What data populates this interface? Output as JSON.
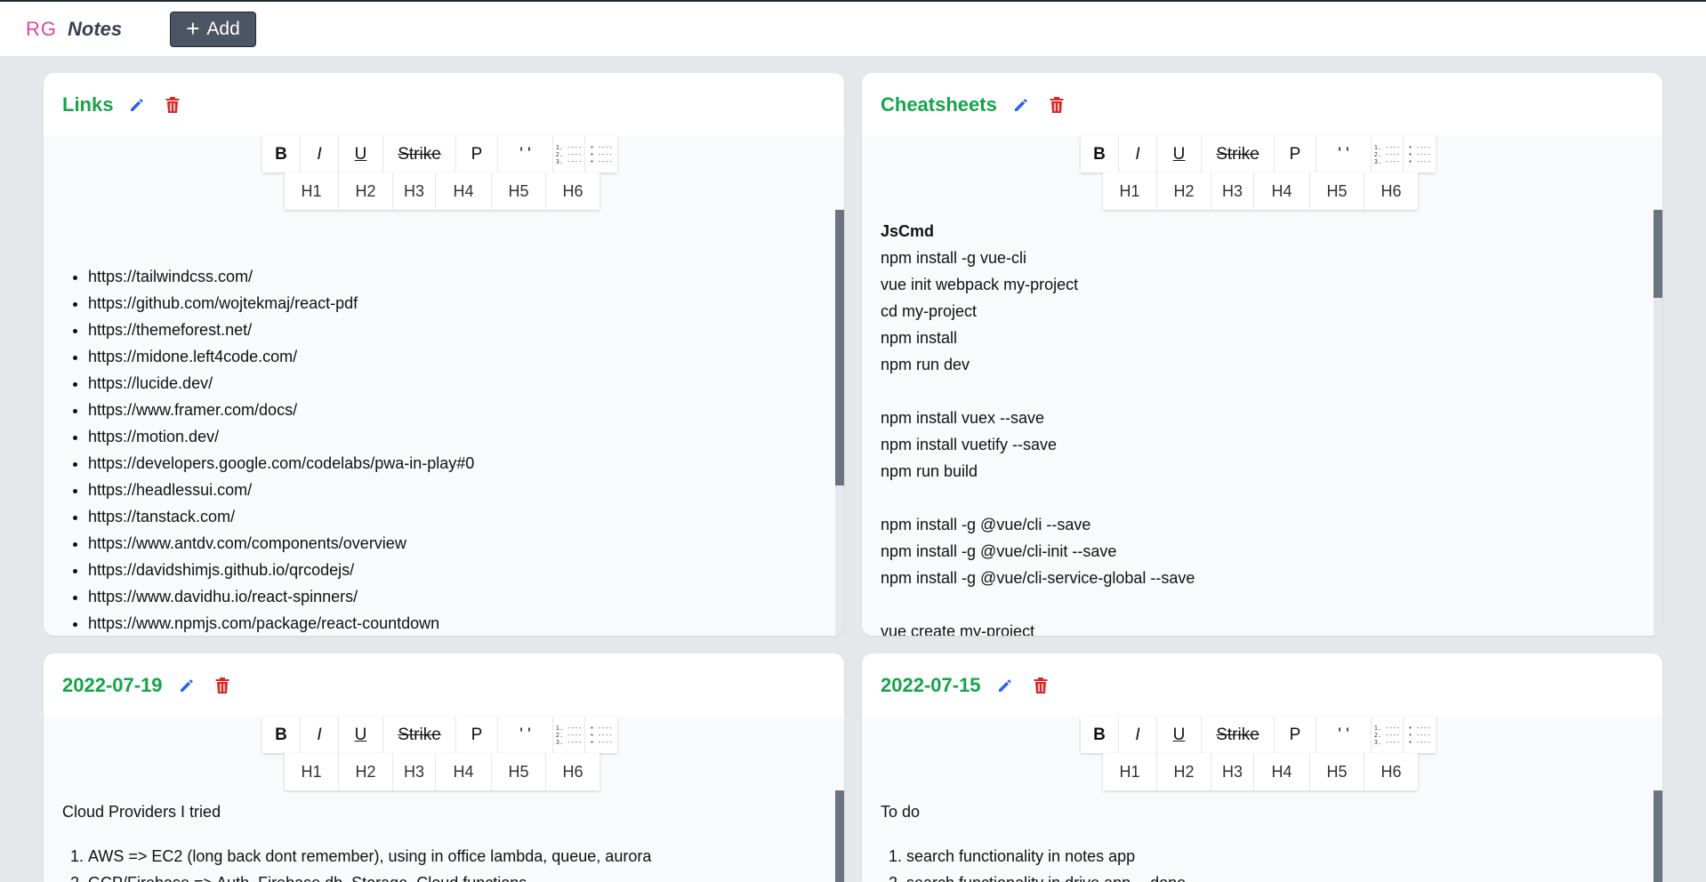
{
  "app": {
    "brand_rg": "RG",
    "brand_notes": "Notes",
    "add_label": "Add"
  },
  "toolbar": {
    "bold": "B",
    "italic": "I",
    "underline": "U",
    "strike": "Strike",
    "paragraph": "P",
    "quote": "' '",
    "ordered_glyph": "1. ----\n2. ----\n3. ----",
    "bullet_glyph": "• ----\n• ----\n• ----",
    "headings": [
      "H1",
      "H2",
      "H3",
      "H4",
      "H5",
      "H6"
    ]
  },
  "notes": [
    {
      "title": "Links",
      "links": [
        "https://tailwindcss.com/",
        "https://github.com/wojtekmaj/react-pdf",
        "https://themeforest.net/",
        "https://midone.left4code.com/",
        "https://lucide.dev/",
        "https://www.framer.com/docs/",
        "https://motion.dev/",
        "https://developers.google.com/codelabs/pwa-in-play#0",
        "https://headlessui.com/",
        "https://tanstack.com/",
        "https://www.antdv.com/components/overview",
        "https://davidshimjs.github.io/qrcodejs/",
        "https://www.davidhu.io/react-spinners/",
        "https://www.npmjs.com/package/react-countdown"
      ]
    },
    {
      "title": "Cheatsheets",
      "heading": "JsCmd",
      "lines": [
        "npm install -g vue-cli",
        "vue init webpack my-project",
        "cd my-project",
        "npm install",
        "npm run dev",
        "",
        "npm install vuex --save",
        "npm install vuetify --save",
        "npm run build",
        "",
        "npm install -g @vue/cli --save",
        "npm install -g @vue/cli-init --save",
        "npm install -g @vue/cli-service-global --save",
        "",
        "vue create my-project"
      ]
    },
    {
      "title": "2022-07-19",
      "intro": "Cloud Providers I tried",
      "items": [
        "AWS => EC2 (long back dont remember), using in office lambda, queue, aurora",
        "GCP/Firebase => Auth, Firebase db, Storage, Cloud functions"
      ]
    },
    {
      "title": "2022-07-15",
      "intro": "To do",
      "items": [
        "search functionality in notes app",
        "search functionality in drive app -- done"
      ]
    }
  ],
  "colors": {
    "title": "#16a34a",
    "edit_icon": "#2563eb",
    "delete_icon": "#dc2626",
    "brand_rg": "#d946a8"
  },
  "icons": {
    "edit": "pencil-icon",
    "delete": "trash-icon",
    "add": "plus-icon"
  }
}
